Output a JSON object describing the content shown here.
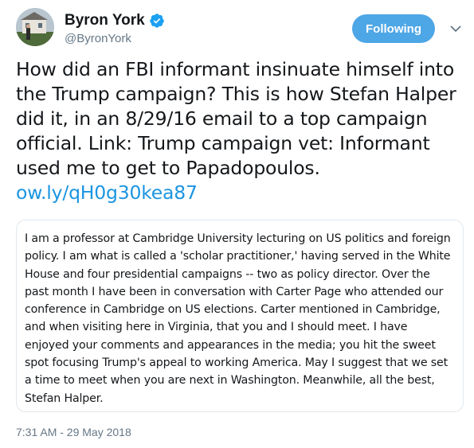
{
  "author": {
    "name": "Byron York",
    "handle": "@ByronYork",
    "verified": true,
    "avatar_icon": "profile-photo"
  },
  "follow_button": {
    "label": "Following",
    "color": "#4da6e6"
  },
  "menu_icon": "chevron-down-icon",
  "tweet": {
    "text": "How did an FBI informant insinuate himself into the Trump campaign? This is how Stefan Halper did it, in an 8/29/16 email to a top campaign official. Link: Trump campaign vet: Informant used me to get to Papadopoulos.",
    "link": "ow.ly/qH0g30kea87",
    "link_color": "#1b95e0"
  },
  "quoted_image": {
    "text": "I am a professor at Cambridge University lecturing on US politics and foreign policy. I am what is called a 'scholar practitioner,' having served in the White House and four presidential campaigns -- two as policy director. Over the past month I have been in conversation with Carter Page who attended our conference in Cambridge on US elections. Carter mentioned in Cambridge, and when visiting here in Virginia, that you and I should meet. I have enjoyed your comments and appearances in the media; you hit the sweet spot focusing Trump's appeal to working America. May I suggest that we set a time to meet when you are next in Washington. Meanwhile, all the best, Stefan Halper."
  },
  "timestamp": "7:31 AM - 29 May 2018"
}
